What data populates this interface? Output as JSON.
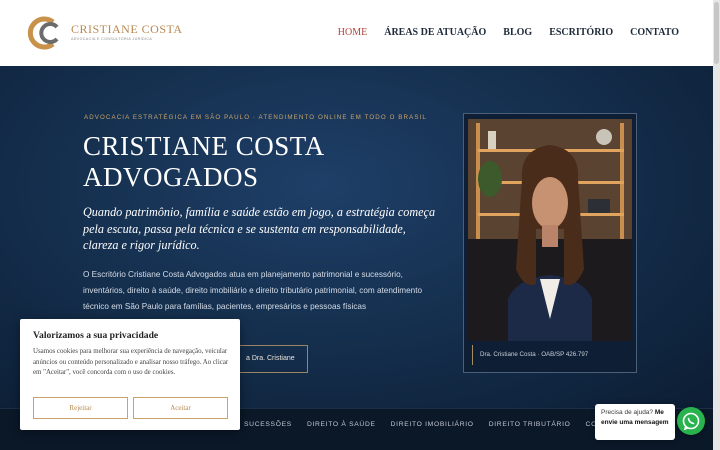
{
  "header": {
    "brand_name": "CRISTIANE COSTA",
    "brand_tagline": "ADVOCACIA E CONSULTORIA JURÍDICA",
    "nav": [
      {
        "label": "HOME",
        "active": true
      },
      {
        "label": "ÁREAS DE ATUAÇÃO",
        "active": false
      },
      {
        "label": "BLOG",
        "active": false
      },
      {
        "label": "ESCRITÓRIO",
        "active": false
      },
      {
        "label": "CONTATO",
        "active": false
      }
    ]
  },
  "hero": {
    "eyebrow": "ADVOCACIA ESTRATÉGICA EM SÃO PAULO · ATENDIMENTO ONLINE EM TODO O BRASIL",
    "title_line1": "CRISTIANE COSTA",
    "title_line2": "ADVOGADOS",
    "lead": "Quando patrimônio, família e saúde estão em jogo, a estratégia começa pela escuta, passa pela técnica e se sustenta em responsabilidade, clareza e rigor jurídico.",
    "body": "O Escritório Cristiane Costa Advogados atua em planejamento patrimonial e sucessório, inventários, direito à saúde, direito imobiliário e direito tributário patrimonial, com atendimento técnico em São Paulo para famílias, pacientes, empresários e pessoas físicas",
    "cta_label": "a Dra. Cristiane",
    "photo_caption": "Dra. Cristiane Costa · OAB/SP 426.797"
  },
  "band_links": [
    "SUCESSÕES",
    "DIREITO À SAÚDE",
    "DIREITO IMOBILIÁRIO",
    "DIREITO TRIBUTÁRIO",
    "CONTATO"
  ],
  "cookie": {
    "title": "Valorizamos a sua privacidade",
    "text": "Usamos cookies para melhorar sua experiência de navegação, veicular anúncios ou conteúdo personalizado e analisar nosso tráfego. Ao clicar em \"Aceitar\", você concorda com o uso de cookies.",
    "reject_label": "Rejeitar",
    "accept_label": "Aceitar"
  },
  "whatsapp": {
    "prompt": "Precisa de ajuda?",
    "action": "Me envie uma mensagem",
    "icon": "whatsapp-icon"
  },
  "colors": {
    "accent_gold": "#c9a36a",
    "nav_active": "#b0443c",
    "hero_bg": "#15304f",
    "whatsapp_green": "#29b34f"
  }
}
